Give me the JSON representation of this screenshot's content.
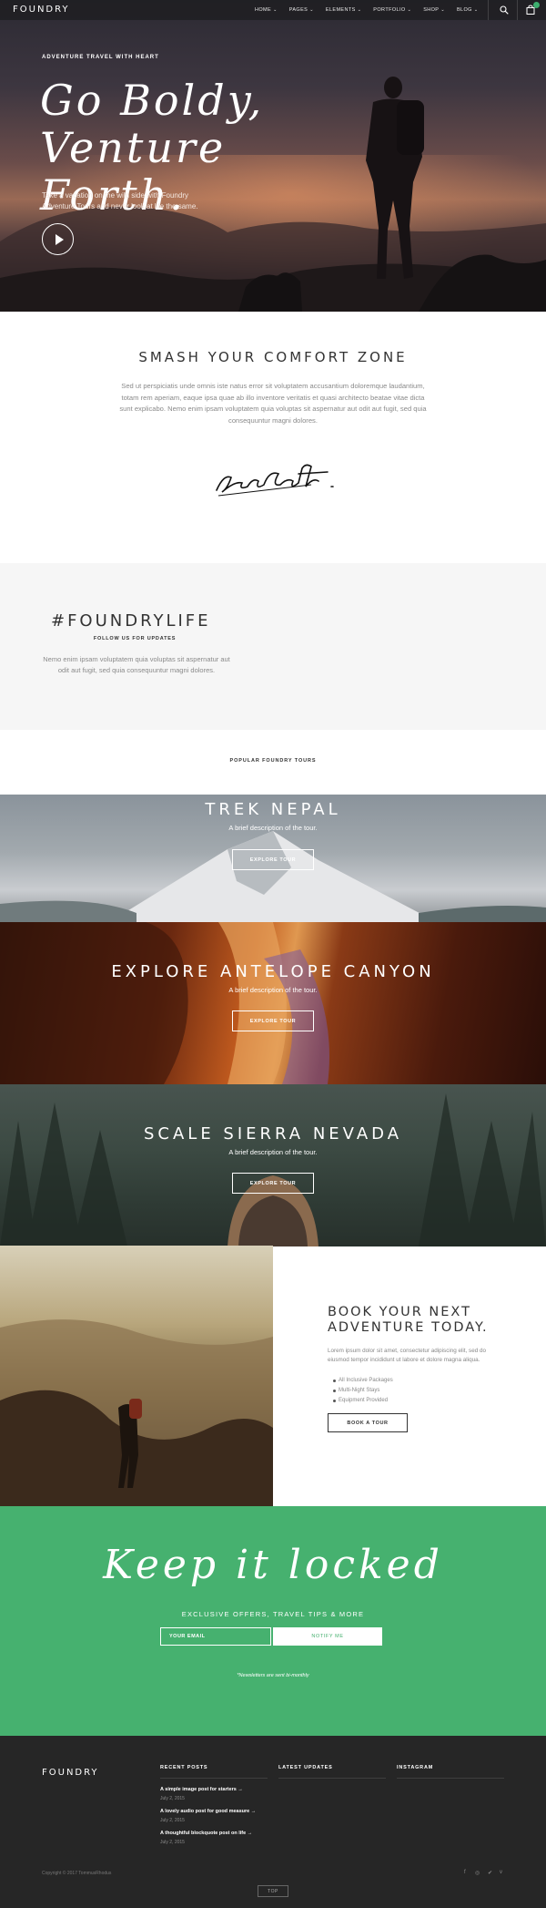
{
  "nav": {
    "brand": "FOUNDRY",
    "items": [
      "HOME",
      "PAGES",
      "ELEMENTS",
      "PORTFOLIO",
      "SHOP",
      "BLOG"
    ],
    "icons": [
      "search-icon",
      "cart-icon"
    ],
    "accent": "#3dae6e"
  },
  "hero": {
    "kicker": "ADVENTURE TRAVEL WITH HEART",
    "title": "Go Boldy, Venture Forth.",
    "subtitle": "Take a vacation on the wild side with Foundry Adventure Tours and never look at life the same."
  },
  "smash": {
    "title": "SMASH YOUR COMFORT ZONE",
    "body": "Sed ut perspiciatis unde omnis iste natus error sit voluptatem accusantium doloremque laudantium, totam rem aperiam, eaque ipsa quae ab illo inventore veritatis et quasi architecto beatae vitae dicta sunt explicabo. Nemo enim ipsam voluptatem quia voluptas sit aspernatur aut odit aut fugit, sed quia consequuntur magni dolores."
  },
  "life": {
    "title": "#FOUNDRYLIFE",
    "follow": "FOLLOW US FOR UPDATES",
    "body": "Nemo enim ipsam voluptatem quia voluptas sit aspernatur aut odit aut fugit, sed quia consequuntur magni dolores."
  },
  "tours": {
    "heading": "POPULAR FOUNDRY TOURS",
    "items": [
      {
        "title": "TREK NEPAL",
        "desc": "A brief description of the tour.",
        "button": "EXPLORE TOUR"
      },
      {
        "title": "EXPLORE ANTELOPE CANYON",
        "desc": "A brief description of the tour.",
        "button": "EXPLORE TOUR"
      },
      {
        "title": "SCALE SIERRA NEVADA",
        "desc": "A brief description of the tour.",
        "button": "EXPLORE TOUR"
      }
    ]
  },
  "book": {
    "title_line1": "BOOK YOUR NEXT",
    "title_line2": "ADVENTURE TODAY.",
    "body": "Lorem ipsum dolor sit amet, consectetur adipiscing elit, sed do eiusmod tempor incididunt ut labore et dolore magna aliqua.",
    "list": [
      "All Inclusive Packages",
      "Multi-Night Stays",
      "Equipment Provided"
    ],
    "button": "BOOK A TOUR"
  },
  "newsletter": {
    "title": "Keep it locked",
    "subtitle": "EXCLUSIVE OFFERS, TRAVEL TIPS & MORE",
    "email_placeholder": "YOUR EMAIL",
    "button": "NOTIFY ME",
    "note": "*Newsletters are sent bi-monthly",
    "bg": "#46b16f"
  },
  "footer": {
    "brand": "FOUNDRY",
    "col_recent": "RECENT POSTS",
    "col_updates": "LATEST UPDATES",
    "col_instagram": "INSTAGRAM",
    "posts": [
      {
        "title": "A simple image post for starters",
        "date": "July 2, 2015"
      },
      {
        "title": "A lovely audio post for good measure",
        "date": "July 2, 2015"
      },
      {
        "title": "A thoughtful blockquote post on life",
        "date": "July 2, 2015"
      }
    ],
    "copyright": "Copyright © 2017 TommusRhodus",
    "social_icons": [
      "facebook-icon",
      "instagram-icon",
      "twitter-icon",
      "vimeo-icon"
    ],
    "top_button": "TOP"
  }
}
